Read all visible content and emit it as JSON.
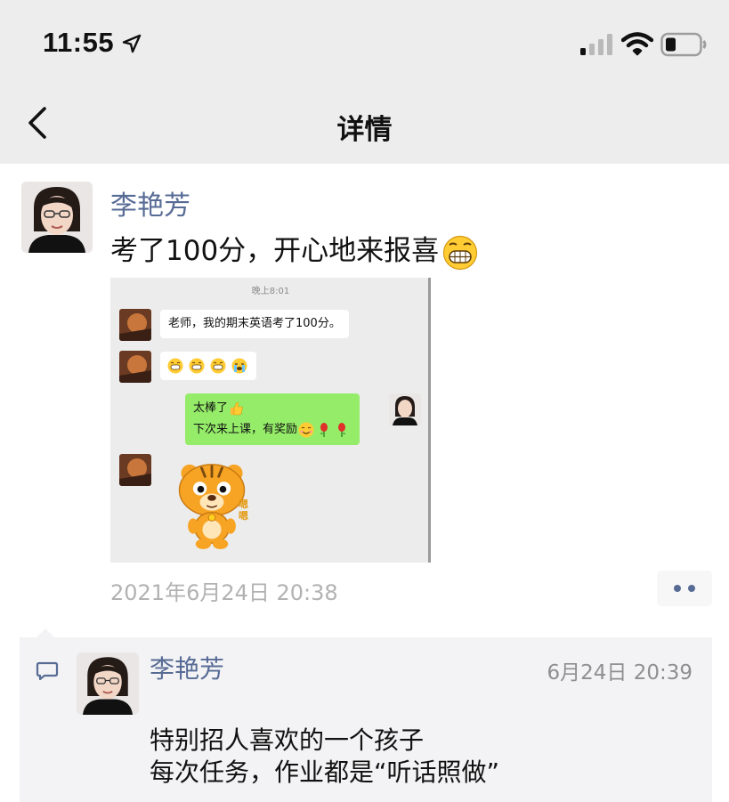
{
  "status_bar": {
    "time": "11:55",
    "icons": [
      "location-arrow-icon",
      "cellular-signal-icon",
      "wifi-icon",
      "battery-icon"
    ]
  },
  "nav": {
    "title": "详情",
    "back_icon": "chevron-left-icon"
  },
  "post": {
    "author": "李艳芳",
    "text": "考了100分，开心地来报喜",
    "emoji": "grinning-face-emoji",
    "date": "2021年6月24日 20:38",
    "more_icon": "two-dots-icon",
    "screenshot": {
      "time": "晚上8:01",
      "messages": [
        {
          "side": "left",
          "text": "老师，我的期末英语考了100分。"
        },
        {
          "side": "left",
          "emojis": [
            "grin-emoji",
            "grin-emoji",
            "grin-emoji",
            "sob-emoji"
          ]
        },
        {
          "side": "right",
          "line1": "太棒了",
          "line1_icon": "thumbs-up-emoji",
          "line2": "下次来上课，有奖励",
          "line2_icons": [
            "smile-emoji",
            "rose-emoji",
            "rose-emoji"
          ]
        },
        {
          "side": "left",
          "sticker": "cartoon-tiger-sticker",
          "sticker_text": "嗯嗯"
        }
      ]
    }
  },
  "comment": {
    "icon": "comment-icon",
    "author": "李艳芳",
    "time": "6月24日 20:39",
    "line1": "特别招人喜欢的一个孩子",
    "line2": "每次任务，作业都是“听话照做”"
  }
}
